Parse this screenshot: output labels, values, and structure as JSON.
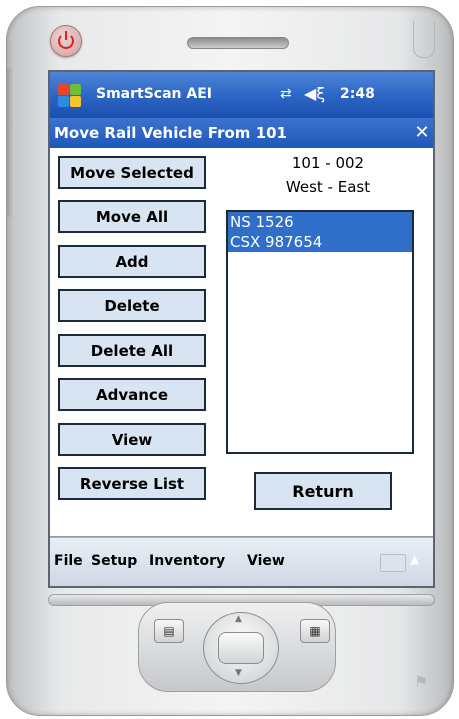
{
  "status_bar": {
    "app_title": "SmartScan AEI",
    "clock": "2:48",
    "connectivity_icon": "connectivity-icon",
    "volume_icon": "volume-muted-icon"
  },
  "form": {
    "title": "Move Rail Vehicle From 101",
    "close_label": "✕"
  },
  "buttons": {
    "move_selected": "Move Selected",
    "move_all": "Move All",
    "add": "Add",
    "delete": "Delete",
    "delete_all": "Delete All",
    "advance": "Advance",
    "view": "View",
    "reverse_list": "Reverse List",
    "return": "Return"
  },
  "track": {
    "id": "101 - 002",
    "direction": "West - East"
  },
  "vehicles": [
    {
      "label": "NS  1526",
      "selected": true
    },
    {
      "label": "CSX 987654",
      "selected": true
    }
  ],
  "menu": {
    "file": "File",
    "setup": "Setup",
    "inventory": "Inventory",
    "view": "View"
  },
  "colors": {
    "titlebar": "#2a64c4",
    "selection": "#2f6fc9",
    "button_face": "#d8e4f2"
  }
}
